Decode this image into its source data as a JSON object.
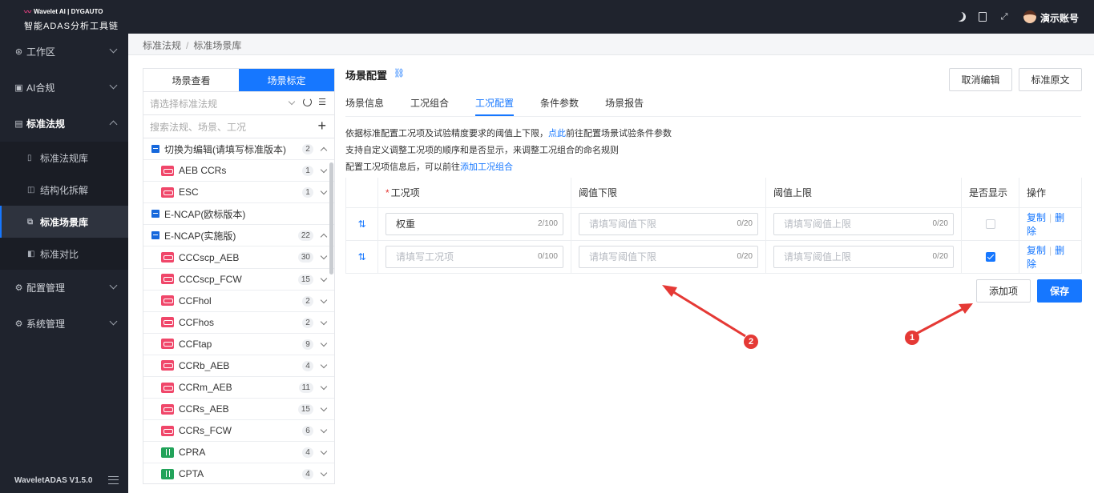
{
  "brand": {
    "logo_top": "Wavelet AI | DYGAUTO",
    "product": "智能ADAS分析工具链",
    "version": "WaveletADAS  V1.5.0"
  },
  "nav": {
    "workspace": "工作区",
    "ai_compliance": "AI合规",
    "standards": "标准法规",
    "standards_sub": [
      "标准法规库",
      "结构化拆解",
      "标准场景库",
      "标准对比"
    ],
    "config": "配置管理",
    "system": "系统管理"
  },
  "header": {
    "account": "演示账号"
  },
  "breadcrumb": [
    "标准法规",
    "标准场景库"
  ],
  "panel": {
    "seg_view": "场景查看",
    "seg_calibrate": "场景标定",
    "select_placeholder": "请选择标准法规",
    "search_placeholder": "搜索法规、场景、工况",
    "tree": [
      {
        "type": "group",
        "label": "切换为编辑(请填写标准版本)",
        "count": "2",
        "open": true
      },
      {
        "type": "child",
        "icon": "car",
        "label": "AEB CCRs",
        "count": "1"
      },
      {
        "type": "child",
        "icon": "car",
        "label": "ESC",
        "count": "1"
      },
      {
        "type": "group",
        "label": "E-NCAP(欧标版本)",
        "count": "",
        "open": false
      },
      {
        "type": "group",
        "label": "E-NCAP(实施版)",
        "count": "22",
        "open": true
      },
      {
        "type": "child",
        "icon": "car",
        "label": "CCCscp_AEB",
        "count": "30"
      },
      {
        "type": "child",
        "icon": "car",
        "label": "CCCscp_FCW",
        "count": "15"
      },
      {
        "type": "child",
        "icon": "car",
        "label": "CCFhol",
        "count": "2"
      },
      {
        "type": "child",
        "icon": "car",
        "label": "CCFhos",
        "count": "2"
      },
      {
        "type": "child",
        "icon": "car",
        "label": "CCFtap",
        "count": "9"
      },
      {
        "type": "child",
        "icon": "car",
        "label": "CCRb_AEB",
        "count": "4"
      },
      {
        "type": "child",
        "icon": "car",
        "label": "CCRm_AEB",
        "count": "11"
      },
      {
        "type": "child",
        "icon": "car",
        "label": "CCRs_AEB",
        "count": "15"
      },
      {
        "type": "child",
        "icon": "car",
        "label": "CCRs_FCW",
        "count": "6"
      },
      {
        "type": "child",
        "icon": "ped",
        "label": "CPRA",
        "count": "4"
      },
      {
        "type": "child",
        "icon": "ped",
        "label": "CPTA",
        "count": "4"
      }
    ]
  },
  "main": {
    "title": "场景配置",
    "cancel_edit": "取消编辑",
    "original_text": "标准原文",
    "tabs": [
      "场景信息",
      "工况组合",
      "工况配置",
      "条件参数",
      "场景报告"
    ],
    "info1_pre": "依据标准配置工况项及试验精度要求的阈值上下限，",
    "info1_link": "点此",
    "info1_post": "前往配置场景试验条件参数",
    "info2": "支持自定义调整工况项的顺序和是否显示，来调整工况组合的命名规则",
    "info3_pre": "配置工况项信息后，可以前往",
    "info3_link": "添加工况组合",
    "table": {
      "headers": {
        "item": "工况项",
        "lower": "阈值下限",
        "upper": "阈值上限",
        "show": "是否显示",
        "ops": "操作"
      },
      "rows": [
        {
          "item_value": "权重",
          "item_placeholder": "请填写工况项",
          "item_count": "2/100",
          "lower_placeholder": "请填写阈值下限",
          "lower_count": "0/20",
          "upper_placeholder": "请填写阈值上限",
          "upper_count": "0/20",
          "show": false
        },
        {
          "item_value": "",
          "item_placeholder": "请填写工况项",
          "item_count": "0/100",
          "lower_placeholder": "请填写阈值下限",
          "lower_count": "0/20",
          "upper_placeholder": "请填写阈值上限",
          "upper_count": "0/20",
          "show": true
        }
      ],
      "copy": "复制",
      "delete": "删除"
    },
    "add_item": "添加项",
    "save": "保存"
  },
  "annotations": {
    "marker1": "1",
    "marker2": "2",
    "color": "#e53935"
  }
}
